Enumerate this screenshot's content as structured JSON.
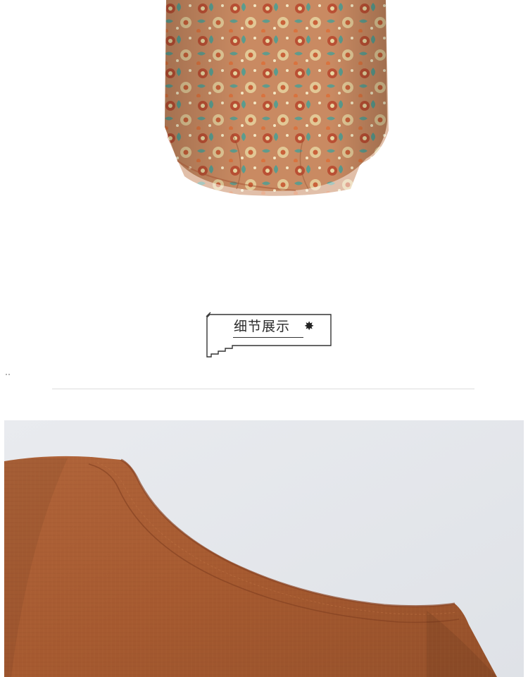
{
  "detail_section": {
    "title": "细节展示",
    "star": "✸"
  },
  "photos": {
    "skirt": {
      "subject": "floral-print-skirt-hem",
      "colors": {
        "base": "#c98a62",
        "accent_teal": "#4f9e93",
        "accent_red": "#b8452c",
        "accent_cream": "#e8d7a2"
      }
    },
    "collar": {
      "subject": "rust-linen-round-neckline",
      "colors": {
        "fabric": "#a65a30",
        "fabric_dark": "#8e4a25",
        "background": "#e6e8ec"
      }
    }
  },
  "colors": {
    "page_background": "#ffffff",
    "divider": "#dedede",
    "badge_border": "#333333"
  }
}
